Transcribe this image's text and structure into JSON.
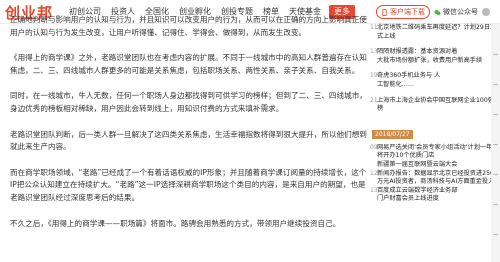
{
  "header": {
    "logo": "创业邦",
    "nav": [
      {
        "label": "初创公司",
        "active": false
      },
      {
        "label": "投资人",
        "active": false
      },
      {
        "label": "全国化",
        "active": false
      },
      {
        "label": "创业孵化",
        "active": false
      },
      {
        "label": "创投专题",
        "active": false
      },
      {
        "label": "榜单",
        "active": false
      },
      {
        "label": "天使基金",
        "active": false
      },
      {
        "label": "更多",
        "active": false
      }
    ],
    "client_download": "客户端下载",
    "wechat": "微信公众号"
  },
  "article": {
    "paragraphs": [
      "正确地判断与影响用户的认知与行为，并且知识可以改变用户的行为，从而可以在正确的方向上影响真正使用户的认知与行为发生改变，让用户听得懂、记得住、学得会、做得到，从而发生改变。",
      "《用得上的商学课》之外，老路识堂团队也在考虑内容的扩展。不同于一线城市中的高知人群普遍存在认知焦虑，二、三、四线城市人群更多的可能是关系焦虑，包括职场关系、两性关系、亲子关系、自我关系。",
      "同时，在一线城市，牛人无数，任何一个职场人身边都找得到可供学习的榜样；但到了二、三、四线城市，身边优秀的榜板相对稀缺，用户因此会转到线上，用知识付费的方式来填补需求。",
      "老路识堂团队判断，后一类人群一旦解决了这四类关系焦虑，生活幸福指数将得到很大提升，所以他们想到就此来生产内容。",
      "而在商学职场领域，“老路”已经成了一个有着话语权威的IP形象；并且随着商学课订阅量的持续增长，这个IP把公众认知建立在持续扩大。“老路”这一IP选择深耕商学职场这个类目的内容，是来自用户的期望，也是老路识堂团队经过深度思考后的结果。",
      "不久之后，《用得上的商学课——职场篇》将面市。路骋会用熟悉的方式，带领用户继续投资自己。"
    ]
  },
  "sidebar": {
    "groups": [
      {
        "items": [
          {
            "num": "11",
            "text": "北京地铁二维码乘车再度延迟？计划29日正式上线"
          }
        ]
      },
      {
        "items": [
          {
            "num": "13",
            "text": "陌陌财报透露：基本资源对着"
          },
          {
            "num": "",
            "text": "大批市场份额扩张，收费用户新高手续"
          }
        ]
      },
      {
        "items": [
          {
            "num": "19",
            "text": "奇虎360手机业务与 人"
          },
          {
            "num": "",
            "text": "工智能化……"
          }
        ]
      },
      {
        "items": [
          {
            "num": "21",
            "text": "上海市上海企业协会中国互联网企业100强榜"
          }
        ]
      }
    ],
    "date_badge": "2018/07/27",
    "group2": [
      {
        "num": "09",
        "text": "网易严选关闭‘会员专家小组活动’计划一年内将开办10个优质门店"
      },
      {
        "num": "",
        "text": "新疆第一届互联网暨云端大会"
      },
      {
        "num": "12",
        "text": "新闻办报告：数据显示北京已经投资进2500万元AI投资者，商汤科技与AI方面重金投入"
      },
      {
        "num": "13",
        "text": "百度成立云端数字经济业务部"
      },
      {
        "num": "",
        "text": "门户财富会员上线进度"
      }
    ]
  }
}
